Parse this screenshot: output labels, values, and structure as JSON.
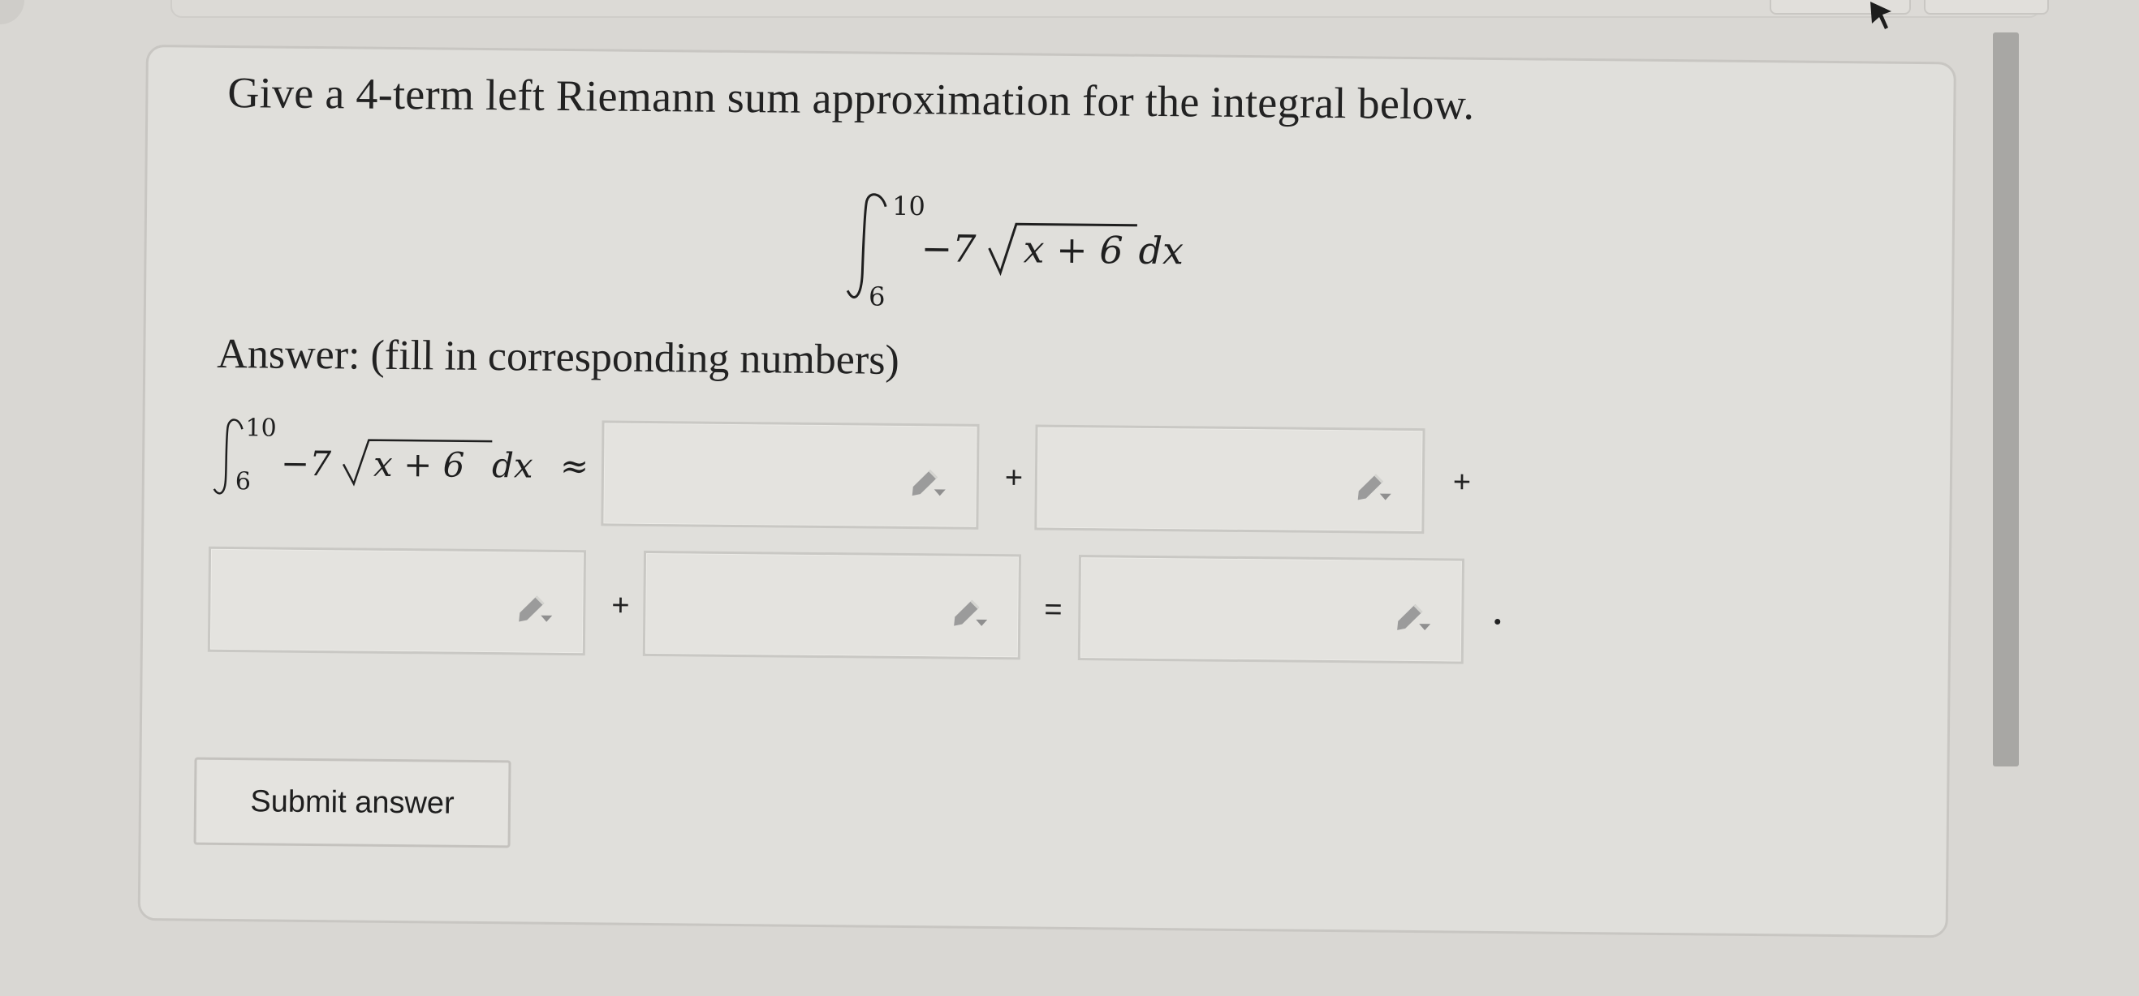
{
  "question": {
    "prompt": "Give a 4-term left Riemann sum approximation for the integral below.",
    "integral": {
      "lower_limit": "6",
      "upper_limit": "10",
      "coefficient": "−7",
      "radicand": "x + 6",
      "differential": "dx"
    },
    "answer_label": "Answer: (fill in corresponding numbers)",
    "approx_symbol": "≈",
    "operators": {
      "plus": "+",
      "equals": "="
    },
    "answer_boxes": [
      {
        "value": "",
        "placeholder": ""
      },
      {
        "value": "",
        "placeholder": ""
      },
      {
        "value": "",
        "placeholder": ""
      },
      {
        "value": "",
        "placeholder": ""
      },
      {
        "value": "",
        "placeholder": ""
      }
    ],
    "submit_label": "Submit answer"
  },
  "icons": {
    "answer_box_icon": "pencil-dropdown-icon",
    "cursor_icon": "mouse-pointer-icon"
  },
  "colors": {
    "page_background": "#d9d7d3",
    "card_background": "#e0dfdb",
    "text": "#222222",
    "border": "#c8c6c2",
    "scrollbar": "#a8a7a4",
    "icon_gray": "#9a9a9a"
  }
}
